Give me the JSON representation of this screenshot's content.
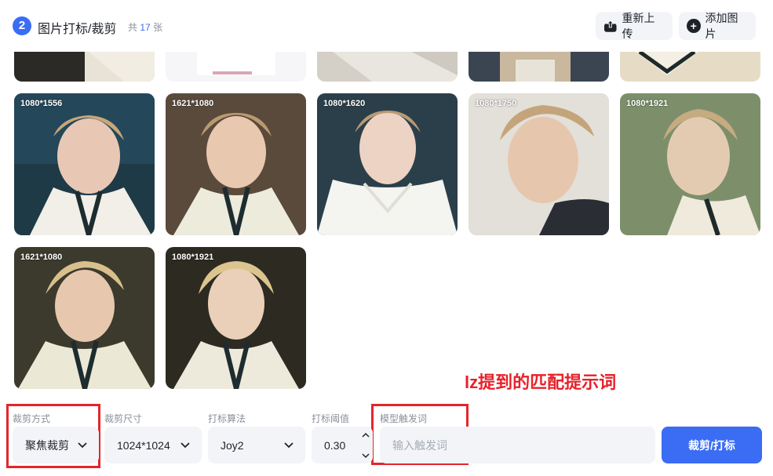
{
  "header": {
    "step_number": "2",
    "title": "图片打标/裁剪",
    "count_prefix": "共",
    "count_value": "17",
    "count_suffix": "张",
    "reupload_label": "重新上传",
    "add_label": "添加图片"
  },
  "gallery": {
    "row1": [
      {
        "dims": "1080*1556"
      },
      {
        "dims": "1621*1080"
      },
      {
        "dims": "1080*1620"
      },
      {
        "dims": "1080*1750"
      },
      {
        "dims": "1080*1921"
      }
    ],
    "row2": [
      {
        "dims": "1621*1080"
      },
      {
        "dims": "1080*1921"
      }
    ]
  },
  "annotation": {
    "text": "lz提到的匹配提示词",
    "color": "#e8202a"
  },
  "controls": {
    "crop_mode": {
      "label": "裁剪方式",
      "value": "聚焦裁剪"
    },
    "crop_size": {
      "label": "裁剪尺寸",
      "value": "1024*1024"
    },
    "tag_algo": {
      "label": "打标算法",
      "value": "Joy2"
    },
    "tag_threshold": {
      "label": "打标阈值",
      "value": "0.30"
    },
    "trigger_word": {
      "label": "模型触发词",
      "placeholder": "输入触发词",
      "value": ""
    },
    "submit_label": "裁剪/打标"
  },
  "colors": {
    "accent": "#3a6cf4",
    "field_bg": "#f2f4f8",
    "annotation_red": "#e3262c"
  }
}
